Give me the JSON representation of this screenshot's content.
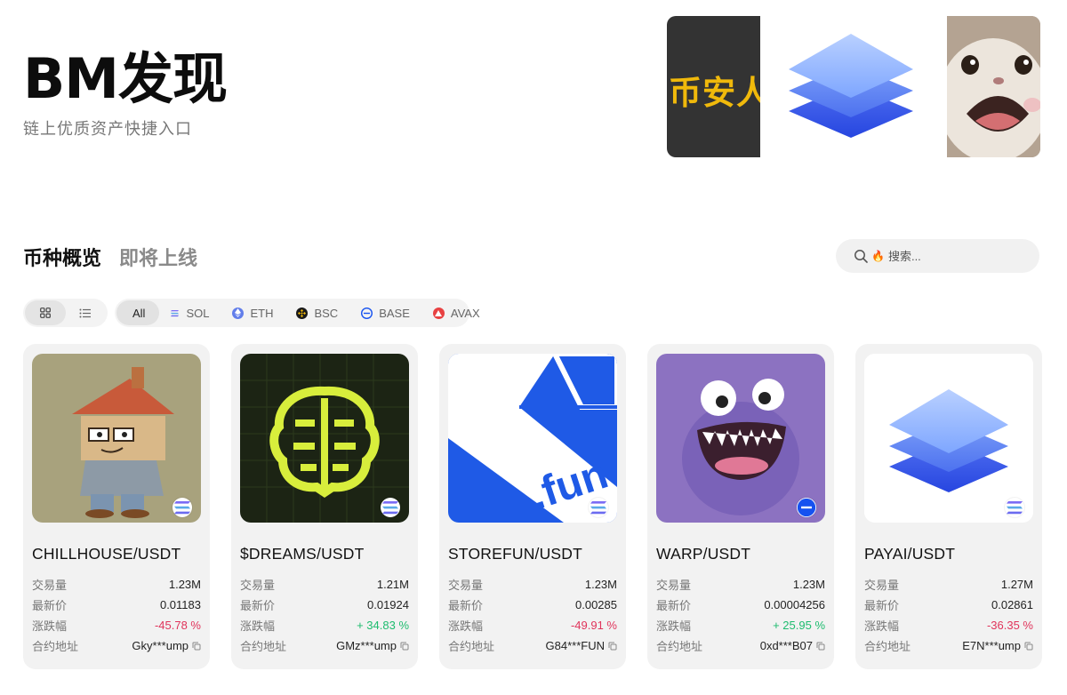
{
  "header": {
    "title": "BM发现",
    "subtitle": "链上优质资产快捷入口"
  },
  "banner": {
    "slides": [
      {
        "text": "币安人",
        "icon": "binance-banner"
      },
      {
        "icon": "layers-logo"
      },
      {
        "icon": "cat-meme"
      }
    ]
  },
  "tabs": [
    {
      "label": "币种概览",
      "active": true
    },
    {
      "label": "即将上线",
      "active": false
    }
  ],
  "search": {
    "icon": "search-icon",
    "hot_icon": "🔥",
    "placeholder": "搜索..."
  },
  "view_modes": [
    {
      "icon": "grid-icon",
      "active": true
    },
    {
      "icon": "list-icon",
      "active": false
    }
  ],
  "chains": [
    {
      "label": "All",
      "active": true
    },
    {
      "label": "SOL",
      "icon": "sol-icon",
      "color": "#6b6bf0"
    },
    {
      "label": "ETH",
      "icon": "eth-icon",
      "color": "#627eea"
    },
    {
      "label": "BSC",
      "icon": "bsc-icon",
      "color": "#f0b90b"
    },
    {
      "label": "BASE",
      "icon": "base-icon",
      "color": "#1652f0"
    },
    {
      "label": "AVAX",
      "icon": "avax-icon",
      "color": "#e84142"
    }
  ],
  "labels": {
    "volume": "交易量",
    "price": "最新价",
    "change": "涨跌幅",
    "contract": "合约地址"
  },
  "tokens": [
    {
      "pair": "CHILLHOUSE/USDT",
      "volume": "1.23M",
      "price": "0.01183",
      "change": "-45.78 %",
      "trend": "down",
      "contract": "Gky***ump",
      "chain": "SOL",
      "image": "chillhouse-art"
    },
    {
      "pair": "$DREAMS/USDT",
      "volume": "1.21M",
      "price": "0.01924",
      "change": "+ 34.83 %",
      "trend": "up",
      "contract": "GMz***ump",
      "chain": "SOL",
      "image": "brain-art"
    },
    {
      "pair": "STOREFUN/USDT",
      "volume": "1.23M",
      "price": "0.00285",
      "change": "-49.91 %",
      "trend": "down",
      "contract": "G84***FUN",
      "chain": "SOL",
      "image": "fun-box-art"
    },
    {
      "pair": "WARP/USDT",
      "volume": "1.23M",
      "price": "0.00004256",
      "change": "+ 25.95 %",
      "trend": "up",
      "contract": "0xd***B07",
      "chain": "BASE",
      "image": "purple-monster-art"
    },
    {
      "pair": "PAYAI/USDT",
      "volume": "1.27M",
      "price": "0.02861",
      "change": "-36.35 %",
      "trend": "down",
      "contract": "E7N***ump",
      "chain": "SOL",
      "image": "layers-logo"
    }
  ],
  "colors": {
    "up": "#1ebc6f",
    "down": "#e0345b",
    "card_bg": "#f2f2f2"
  }
}
